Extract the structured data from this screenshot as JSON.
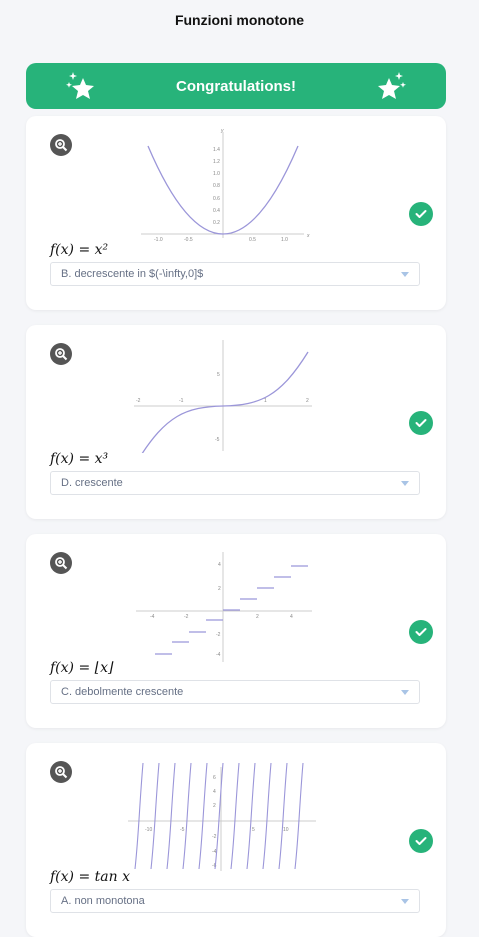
{
  "page": {
    "title": "Funzioni monotone"
  },
  "banner": {
    "text": "Congratulations!",
    "color": "#27b37a",
    "icon": "sparkle-star-icon"
  },
  "cards": [
    {
      "function": "f(x) = x²",
      "answer": "B. decrescente in $(-\\infty,0]$",
      "status": "correct"
    },
    {
      "function": "f(x) = x³",
      "answer": "D. crescente",
      "status": "correct"
    },
    {
      "function": "f(x) = ⌊x⌋",
      "answer": "C. debolmente crescente",
      "status": "correct"
    },
    {
      "function": "f(x) = tan x",
      "answer": "A. non monotona",
      "status": "correct"
    }
  ],
  "graphs": {
    "g1": {
      "x_ticks": [
        "-1.0",
        "-0.5",
        "0.5",
        "1.0"
      ],
      "y_ticks": [
        "0.2",
        "0.4",
        "0.6",
        "0.8",
        "1.0",
        "1.2",
        "1.4"
      ],
      "x_label": "x",
      "y_label": "y"
    },
    "g2": {
      "x_ticks": [
        "-2",
        "-1",
        "1",
        "2"
      ],
      "y_ticks": [
        "5",
        "-5"
      ]
    },
    "g3": {
      "x_ticks": [
        "-4",
        "-2",
        "2",
        "4"
      ],
      "y_ticks": [
        "4",
        "2",
        "-2",
        "-4"
      ]
    },
    "g4": {
      "x_ticks": [
        "-10",
        "-5",
        "5",
        "10"
      ],
      "y_ticks": [
        "6",
        "4",
        "2",
        "-2",
        "-4",
        "-6"
      ]
    }
  },
  "colors": {
    "accent": "#27b37a",
    "curve": "#9b96d9",
    "select_text": "#667085"
  }
}
